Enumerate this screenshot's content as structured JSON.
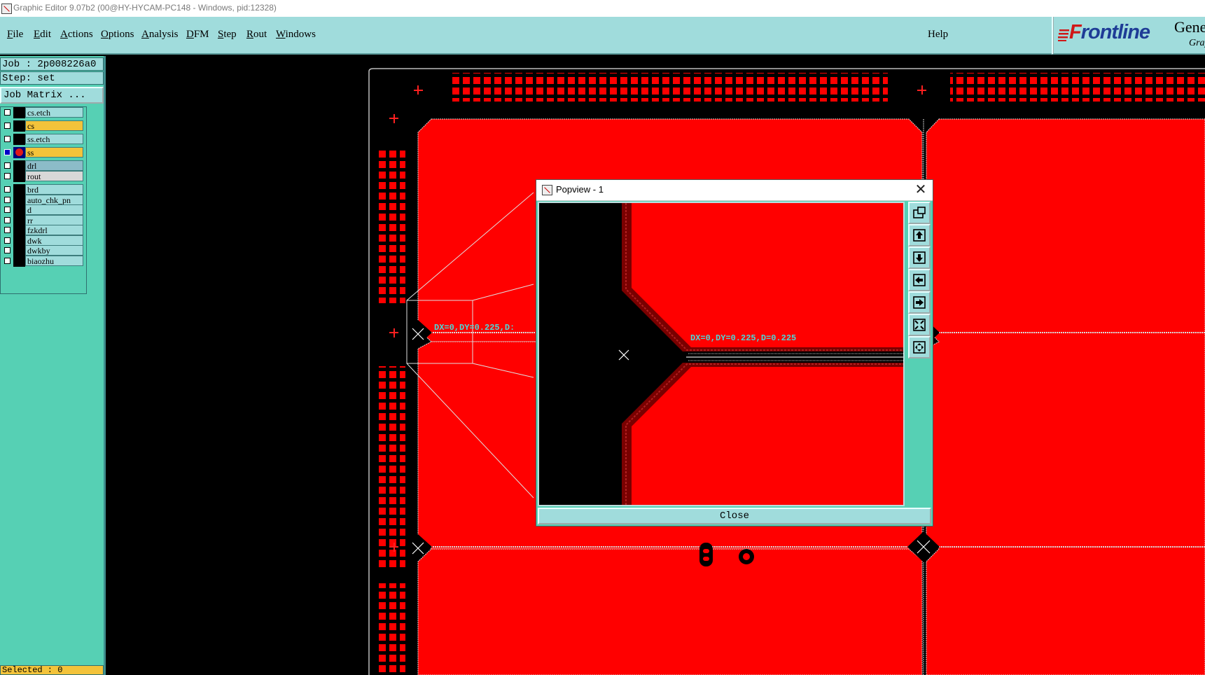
{
  "window": {
    "title": "Graphic Editor 9.07b2 (00@HY-HYCAM-PC148 - Windows, pid:12328)"
  },
  "menu": {
    "items": [
      {
        "u": "F",
        "rest": "ile"
      },
      {
        "u": "E",
        "rest": "dit"
      },
      {
        "u": "A",
        "rest": "ctions"
      },
      {
        "u": "O",
        "rest": "ptions"
      },
      {
        "u": "A",
        "rest": "nalysis"
      },
      {
        "u": "D",
        "rest": "FM"
      },
      {
        "u": "S",
        "rest": "tep"
      },
      {
        "u": "R",
        "rest": "out"
      },
      {
        "u": "W",
        "rest": "indows"
      }
    ],
    "help": "Help"
  },
  "brand": {
    "logo_first": "F",
    "logo_rest": "rontline",
    "product": "Gene",
    "subtitle": "Grap"
  },
  "job": {
    "job_line": "Job : 2p008226a0",
    "step_line": "Step: set"
  },
  "job_matrix_label": "Job Matrix ...",
  "layers": [
    {
      "name": "cs.etch",
      "color": "#a0dcdc",
      "swatch": "#000000",
      "active": false
    },
    {
      "name": "cs",
      "color": "#f3c33a",
      "swatch": "#000000",
      "active": false
    },
    {
      "name": "ss.etch",
      "color": "#a0dcdc",
      "swatch": "#000000",
      "active": false
    },
    {
      "name": "ss",
      "color": "#f3c33a",
      "swatch": "#000000",
      "active": true
    },
    {
      "name": "drl",
      "color": "#8cbcc8",
      "swatch": "#000000",
      "active": false
    },
    {
      "name": "rout",
      "color": "#d8d8d8",
      "swatch": "#000000",
      "active": false
    },
    {
      "name": "brd",
      "color": "#a0dcdc",
      "swatch": "#000000",
      "active": false
    },
    {
      "name": "auto_chk_pn",
      "color": "#a0dcdc",
      "swatch": "#000000",
      "active": false
    },
    {
      "name": "d",
      "color": "#a0dcdc",
      "swatch": "#000000",
      "active": false
    },
    {
      "name": "rr",
      "color": "#a0dcdc",
      "swatch": "#000000",
      "active": false
    },
    {
      "name": "fzkdrl",
      "color": "#a0dcdc",
      "swatch": "#000000",
      "active": false
    },
    {
      "name": "dwk",
      "color": "#a0dcdc",
      "swatch": "#000000",
      "active": false
    },
    {
      "name": "dwkby",
      "color": "#a0dcdc",
      "swatch": "#000000",
      "active": false
    },
    {
      "name": "biaozhu",
      "color": "#a0dcdc",
      "swatch": "#000000",
      "active": false
    }
  ],
  "selected_label": "Selected : 0",
  "measure": {
    "main": "DX=0,DY=0.225,D:",
    "popup": "DX=0,DY=0.225,D=0.225"
  },
  "popview": {
    "title": "Popview - 1",
    "close_label": "Close",
    "tools": [
      "zoom-window-icon",
      "pan-up-icon",
      "pan-down-icon",
      "pan-left-icon",
      "pan-right-icon",
      "zoom-out-icon",
      "zoom-in-icon"
    ]
  },
  "colors": {
    "copper": "#ff0000",
    "background": "#000000",
    "panel": "#56d0b4",
    "menubar": "#a0dcdc",
    "highlight": "#f3c33a",
    "measure_text": "#4dd8d8"
  }
}
